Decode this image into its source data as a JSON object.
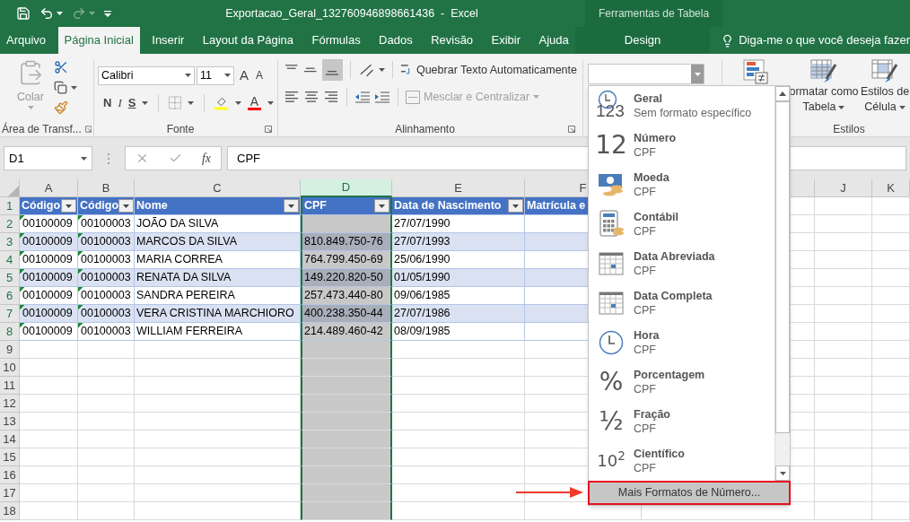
{
  "window": {
    "title": "Exportacao_Geral_132760946898661436  -  Excel",
    "context_title": "Ferramentas de Tabela"
  },
  "tabs": [
    {
      "label": "Arquivo",
      "selected": false,
      "contextual": false
    },
    {
      "label": "Página Inicial",
      "selected": true,
      "contextual": false
    },
    {
      "label": "Inserir",
      "selected": false,
      "contextual": false
    },
    {
      "label": "Layout da Página",
      "selected": false,
      "contextual": false
    },
    {
      "label": "Fórmulas",
      "selected": false,
      "contextual": false
    },
    {
      "label": "Dados",
      "selected": false,
      "contextual": false
    },
    {
      "label": "Revisão",
      "selected": false,
      "contextual": false
    },
    {
      "label": "Exibir",
      "selected": false,
      "contextual": false
    },
    {
      "label": "Ajuda",
      "selected": false,
      "contextual": false
    },
    {
      "label": "Design",
      "selected": false,
      "contextual": true
    }
  ],
  "tell_me": "Diga-me o que você deseja fazer",
  "ribbon": {
    "clipboard": {
      "paste": "Colar",
      "label": "Área de Transf..."
    },
    "font": {
      "name": "Calibri",
      "size": "11",
      "grow": "A",
      "shrink": "A",
      "bold": "N",
      "italic": "I",
      "underline": "S",
      "color_letter": "A",
      "label": "Fonte"
    },
    "alignment": {
      "wrap": "Quebrar Texto Automaticamente",
      "merge": "Mesclar e Centralizar",
      "merge_disabled": true,
      "label": "Alinhamento"
    },
    "styles": {
      "format_table": [
        "ormatar como",
        "Tabela"
      ],
      "cell_styles": [
        "Estilos de",
        "Célula"
      ],
      "label": "Estilos"
    }
  },
  "formula_bar": {
    "name_box": "D1",
    "fx_label": "fx",
    "formula": "CPF"
  },
  "sheet": {
    "columns": [
      {
        "label": "A",
        "selected": false
      },
      {
        "label": "B",
        "selected": false
      },
      {
        "label": "C",
        "selected": false
      },
      {
        "label": "D",
        "selected": true
      },
      {
        "label": "E",
        "selected": false
      },
      {
        "label": "F",
        "selected": false
      },
      {
        "label": "J",
        "selected": false
      },
      {
        "label": "K",
        "selected": false
      }
    ],
    "row_numbers": [
      "1",
      "2",
      "3",
      "4",
      "5",
      "6",
      "7",
      "8",
      "9",
      "10",
      "11",
      "12",
      "13",
      "14",
      "15",
      "16",
      "17",
      "18"
    ],
    "table": {
      "headers": [
        {
          "label": "Código",
          "filter": true
        },
        {
          "label": "Código",
          "filter": true
        },
        {
          "label": "Nome",
          "filter": true
        },
        {
          "label": "CPF",
          "filter": true
        },
        {
          "label": "Data de Nascimento",
          "filter": true
        },
        {
          "label": "Matrícula e",
          "filter": false
        }
      ],
      "rows": [
        {
          "codigo_1": "00100009",
          "codigo_2": "00100003",
          "nome": "JOÃO DA SILVA",
          "data_nascimento": "27/07/1990",
          "text_number_flag": true
        },
        {
          "codigo_1": "00100009",
          "codigo_2": "00100003",
          "nome": "MARCOS DA SILVA",
          "cpf": "810.849.750-76",
          "data_nascimento": "27/07/1993",
          "text_number_flag": true
        },
        {
          "codigo_1": "00100009",
          "codigo_2": "00100003",
          "nome": "MARIA CORREA",
          "cpf": "764.799.450-69",
          "data_nascimento": "25/06/1990",
          "text_number_flag": true
        },
        {
          "codigo_1": "00100009",
          "codigo_2": "00100003",
          "nome": "RENATA DA SILVA",
          "cpf": "149.220.820-50",
          "data_nascimento": "01/05/1990",
          "text_number_flag": true
        },
        {
          "codigo_1": "00100009",
          "codigo_2": "00100003",
          "nome": "SANDRA PEREIRA",
          "cpf": "257.473.440-80",
          "data_nascimento": "09/06/1985",
          "text_number_flag": true
        },
        {
          "codigo_1": "00100009",
          "codigo_2": "00100003",
          "nome": "VERA CRISTINA MARCHIORO",
          "cpf": "400.238.350-44",
          "data_nascimento": "27/07/1986",
          "text_number_flag": true
        },
        {
          "codigo_1": "00100009",
          "codigo_2": "00100003",
          "nome": "WILLIAM FERREIRA",
          "cpf": "214.489.460-42",
          "data_nascimento": "08/09/1985",
          "text_number_flag": true
        }
      ]
    }
  },
  "number_format_menu": {
    "items": [
      {
        "kind": "general",
        "symbol": "123",
        "title": "Geral",
        "sample": "Sem formato específico"
      },
      {
        "kind": "number",
        "symbol": "12",
        "title": "Número",
        "sample": "CPF"
      },
      {
        "kind": "currency",
        "title": "Moeda",
        "sample": "CPF"
      },
      {
        "kind": "accounting",
        "title": "Contábil",
        "sample": "CPF"
      },
      {
        "kind": "short_date",
        "title": "Data Abreviada",
        "sample": "CPF"
      },
      {
        "kind": "long_date",
        "title": "Data Completa",
        "sample": "CPF"
      },
      {
        "kind": "time",
        "title": "Hora",
        "sample": "CPF"
      },
      {
        "kind": "percent",
        "symbol": "%",
        "title": "Porcentagem",
        "sample": "CPF"
      },
      {
        "kind": "fraction",
        "symbol": "½",
        "title": "Fração",
        "sample": "CPF"
      },
      {
        "kind": "scientific",
        "symbol": "10$^{2}$",
        "title": "Científico",
        "sample": "CPF"
      }
    ],
    "more_button": "Mais Formatos de Número...",
    "more_highlighted": true
  }
}
